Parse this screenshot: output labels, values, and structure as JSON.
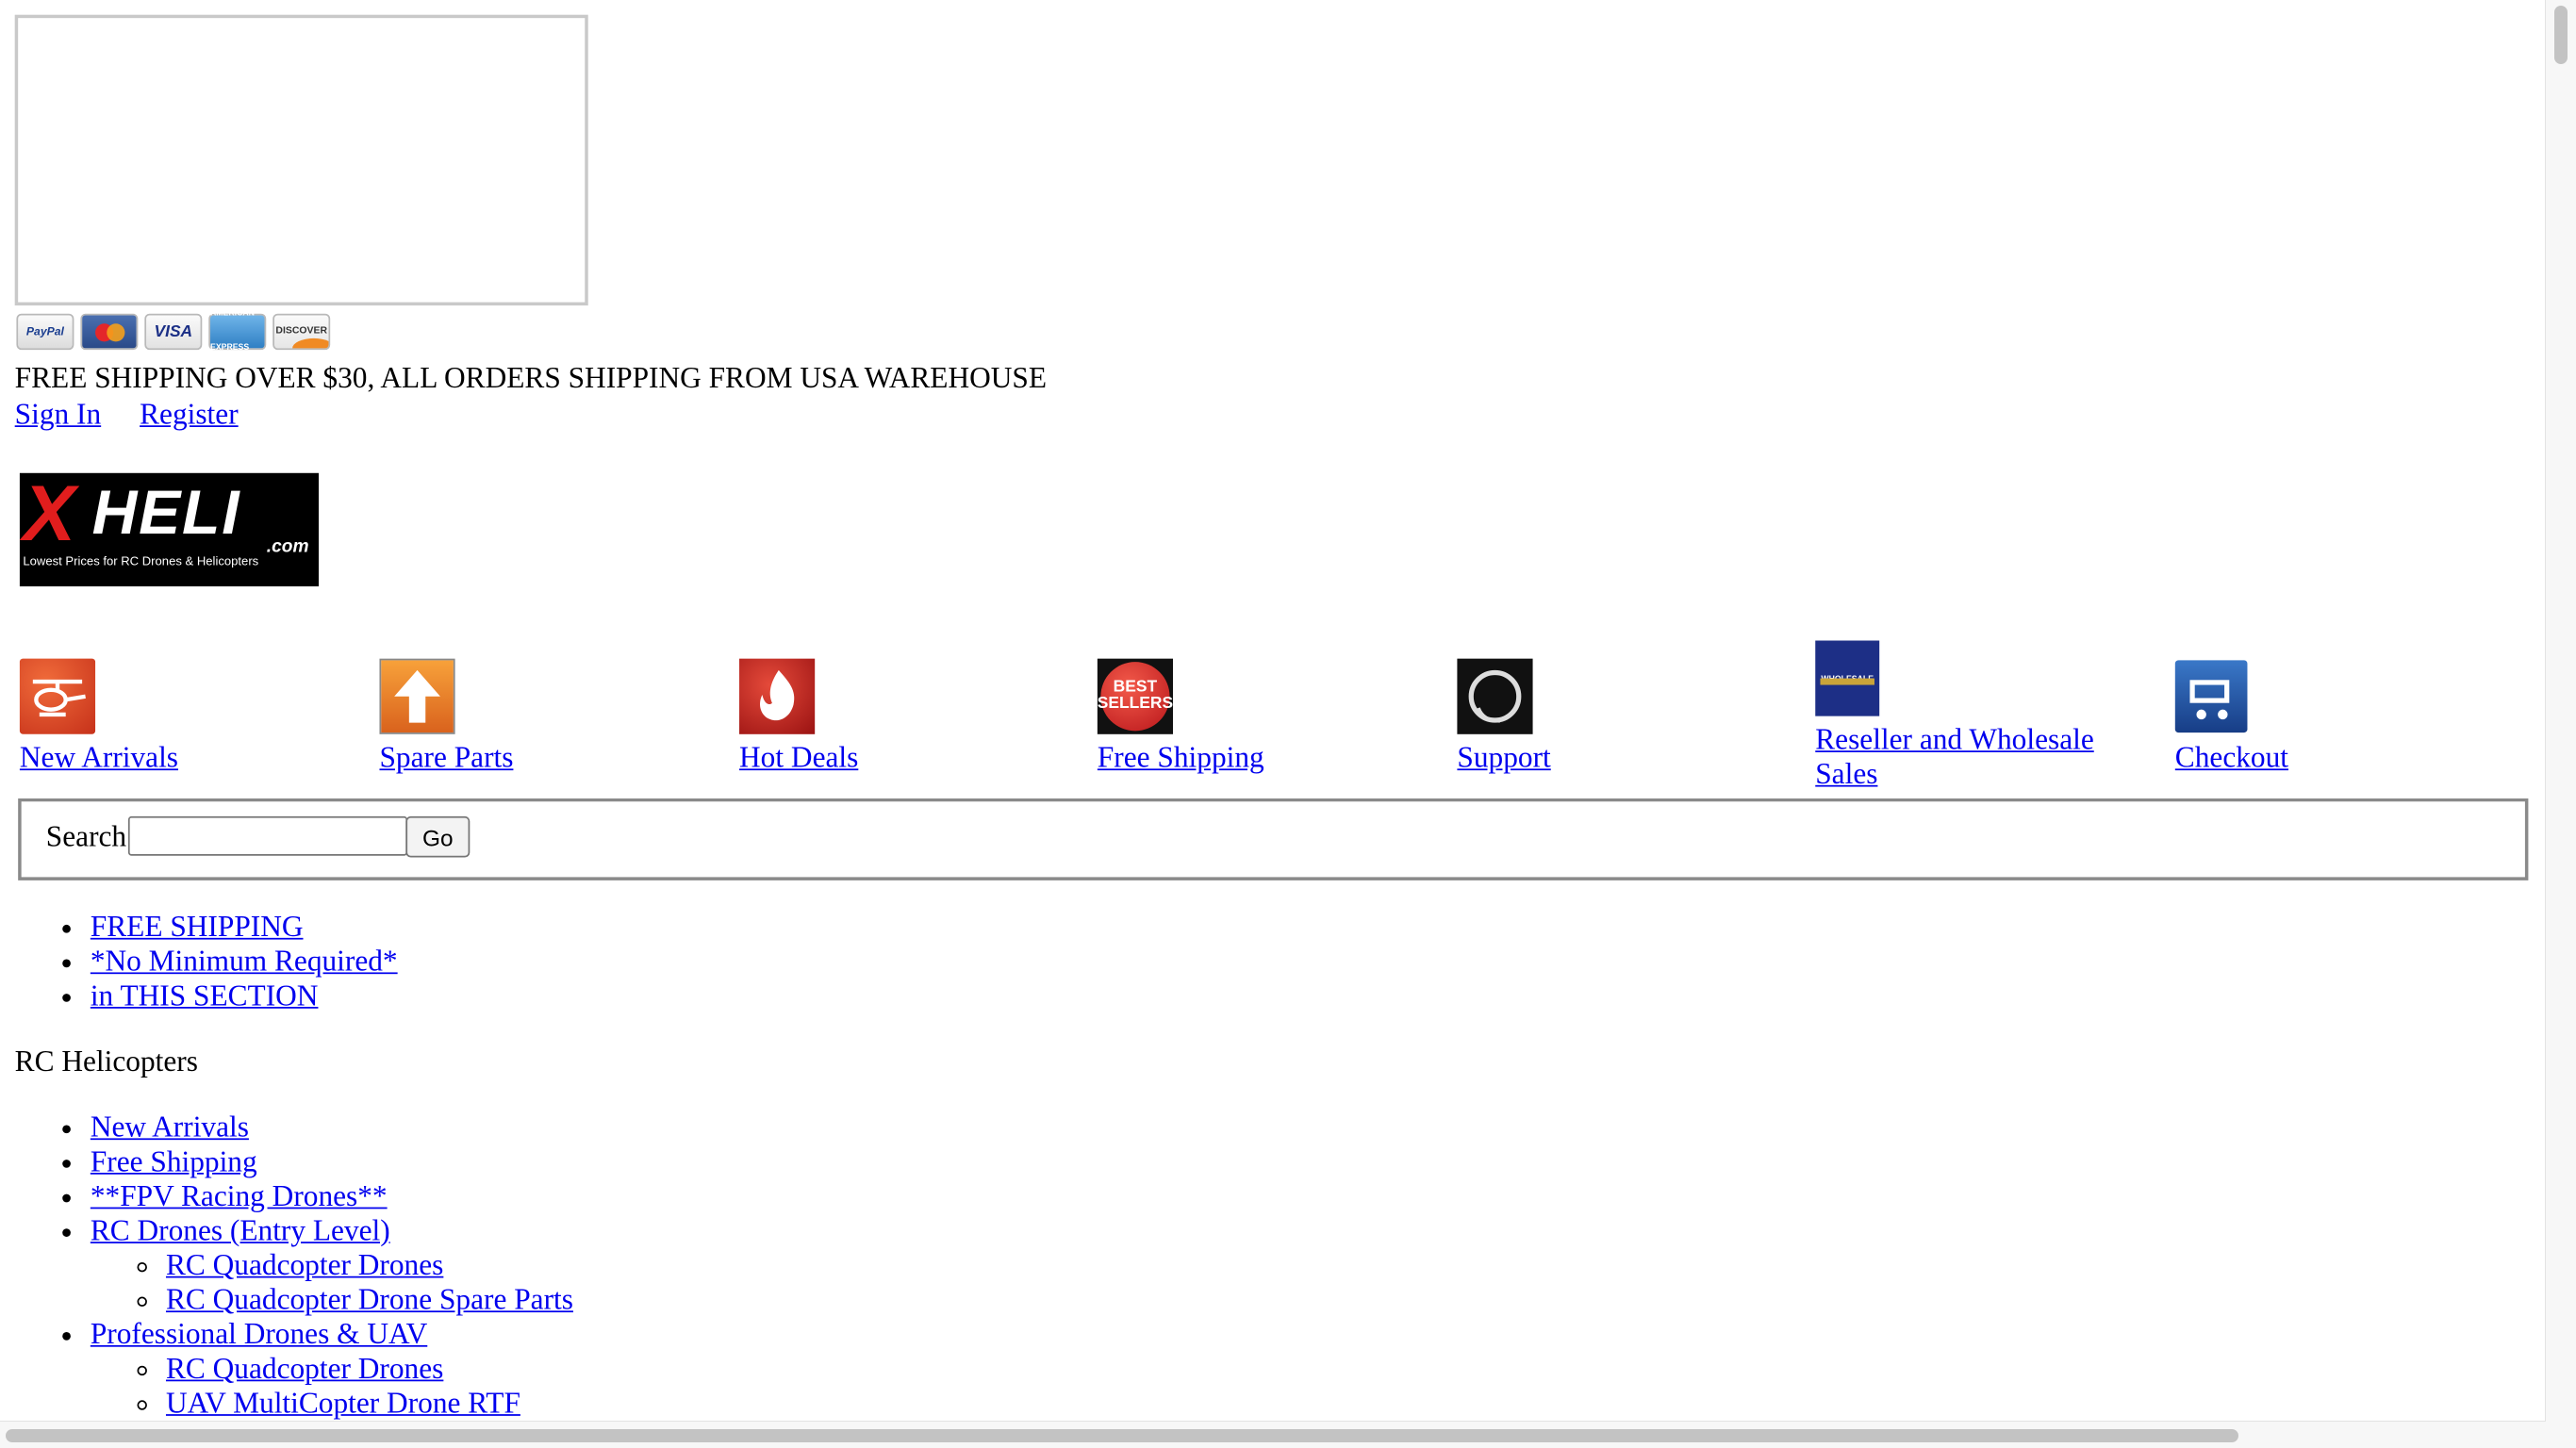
{
  "payment_methods": [
    "PayPal",
    "MasterCard",
    "VISA",
    "AMERICAN EXPRESS",
    "DISCOVER"
  ],
  "header": {
    "shipping_notice": "FREE SHIPPING OVER $30, ALL ORDERS SHIPPING FROM USA WAREHOUSE",
    "sign_in": "Sign In",
    "register": "Register"
  },
  "logo": {
    "brand_x": "X",
    "brand_rest": "HELI",
    "domain": ".com",
    "tagline": "Lowest Prices for RC Drones & Helicopters"
  },
  "nav": [
    {
      "label": "New Arrivals",
      "icon": "helicopter-icon"
    },
    {
      "label": "Spare Parts",
      "icon": "up-arrow-icon"
    },
    {
      "label": "Hot Deals",
      "icon": "flame-icon"
    },
    {
      "label": "Free Shipping",
      "icon": "best-sellers-icon",
      "badge_line1": "BEST",
      "badge_line2": "SELLERS"
    },
    {
      "label": "Support",
      "icon": "headset-icon"
    },
    {
      "label": "Reseller and Wholesale Sales",
      "icon": "wholesale-icon",
      "badge": "WHOLESALE"
    },
    {
      "label": "Checkout",
      "icon": "cart-icon"
    }
  ],
  "search": {
    "label": "Search",
    "value": "",
    "button": "Go"
  },
  "promo_links": [
    "FREE SHIPPING",
    "*No Minimum Required*",
    "in THIS SECTION"
  ],
  "section_title": "RC Helicopters",
  "categories": {
    "new_arrivals": "New Arrivals",
    "free_shipping": "Free Shipping",
    "fpv": "**FPV Racing Drones**",
    "entry": "RC Drones (Entry Level)",
    "entry_sub": [
      "RC Quadcopter Drones",
      "RC Quadcopter Drone Spare Parts"
    ],
    "pro": "Professional Drones & UAV",
    "pro_sub": [
      "RC Quadcopter Drones",
      "UAV MultiCopter Drone RTF"
    ]
  }
}
